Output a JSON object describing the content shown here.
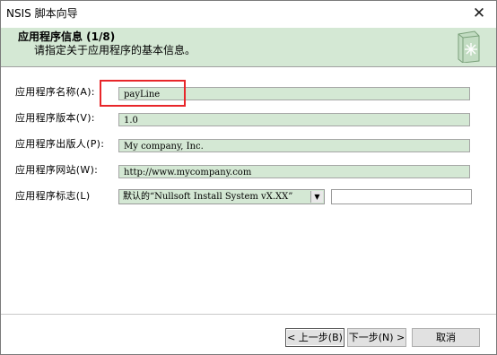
{
  "window": {
    "title": "NSIS 脚本向导",
    "close_glyph": "✕"
  },
  "header": {
    "title": "应用程序信息 (1/8)",
    "subtitle": "请指定关于应用程序的基本信息。",
    "icon": "wizard-book-icon"
  },
  "fields": [
    {
      "label": "应用程序名称(A):",
      "value": "payLine"
    },
    {
      "label": "应用程序版本(V):",
      "value": "1.0"
    },
    {
      "label": "应用程序出版人(P):",
      "value": "My company, Inc."
    },
    {
      "label": "应用程序网站(W):",
      "value": "http://www.mycompany.com"
    }
  ],
  "branding": {
    "label": "应用程序标志(L)",
    "selected": "默认的“Nullsoft Install System vX.XX”",
    "custom_value": ""
  },
  "buttons": {
    "back": "< 上一步(B)",
    "next": "下一步(N) >",
    "cancel": "取消"
  },
  "colors": {
    "field_bg": "#d4e8d4",
    "header_bg": "#d4e8d4",
    "highlight": "#e8262a"
  }
}
